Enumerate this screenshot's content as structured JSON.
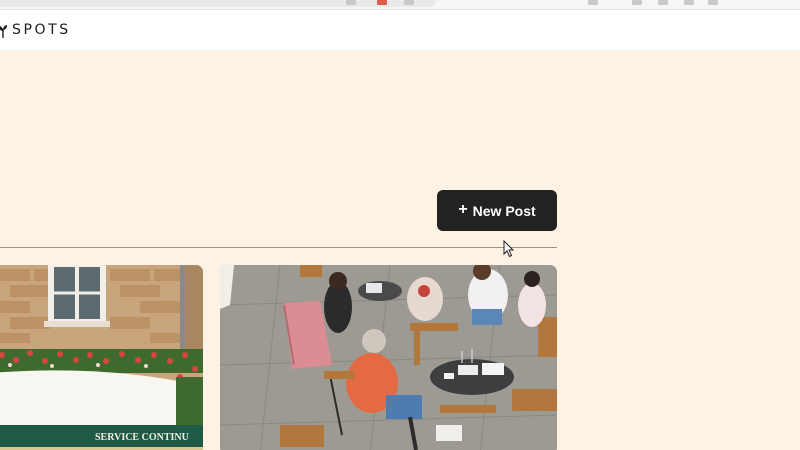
{
  "brand": {
    "name": "SPOTS",
    "logo_icon": "flower-icon"
  },
  "actions": {
    "new_post_label": "New Post",
    "new_post_icon": "plus-icon"
  },
  "posts": [
    {
      "image_icon": "building-photo",
      "sign_text": "SERVICE CONTINU"
    },
    {
      "image_icon": "cafe-terrace-photo"
    }
  ],
  "colors": {
    "page_background": "#fdf2e3",
    "header_background": "#ffffff",
    "button_background": "#222222",
    "button_text": "#ffffff"
  }
}
